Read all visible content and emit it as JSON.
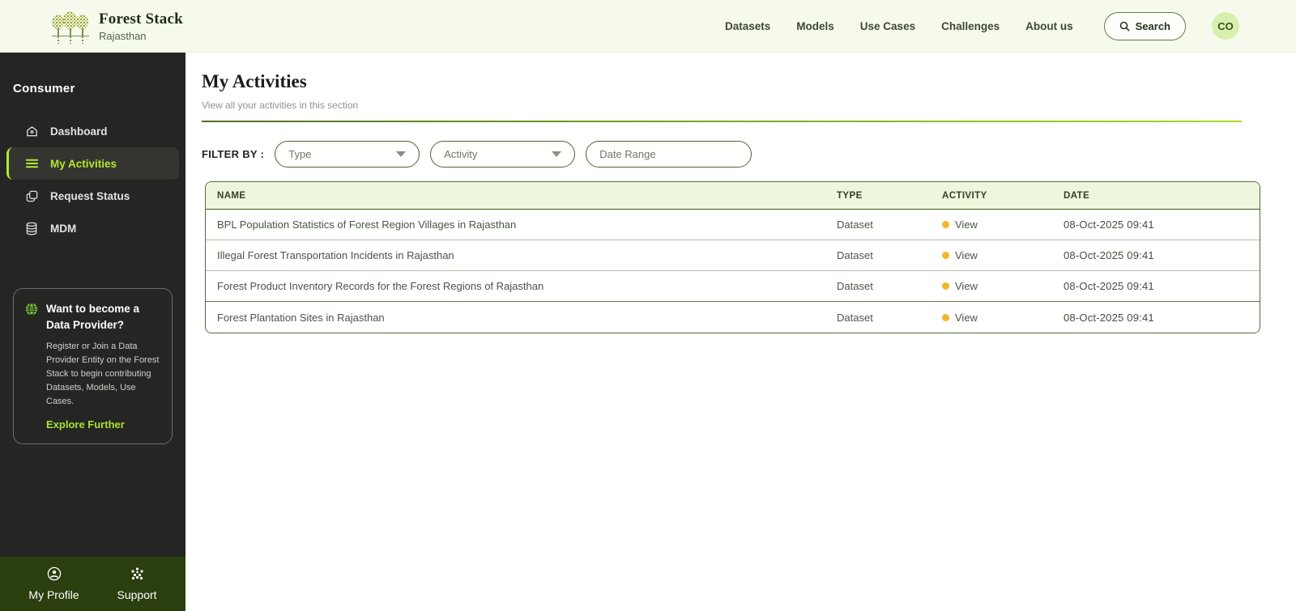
{
  "header": {
    "brand": {
      "title": "Forest Stack",
      "subtitle": "Rajasthan"
    },
    "nav": [
      {
        "label": "Datasets"
      },
      {
        "label": "Models"
      },
      {
        "label": "Use Cases"
      },
      {
        "label": "Challenges"
      },
      {
        "label": "About us"
      }
    ],
    "search_label": "Search",
    "avatar_initials": "CO"
  },
  "sidebar": {
    "role": "Consumer",
    "items": [
      {
        "label": "Dashboard",
        "icon": "home-icon",
        "active": false
      },
      {
        "label": "My Activities",
        "icon": "menu-lines-icon",
        "active": true
      },
      {
        "label": "Request Status",
        "icon": "copy-pages-icon",
        "active": false
      },
      {
        "label": "MDM",
        "icon": "database-icon",
        "active": false
      }
    ],
    "promo": {
      "title": "Want to become a Data Provider?",
      "body": "Register or Join a Data Provider Entity on the Forest Stack to begin contributing Datasets, Models, Use Cases.",
      "link": "Explore Further"
    },
    "footer": [
      {
        "label": "My Profile",
        "icon": "profile-icon"
      },
      {
        "label": "Support",
        "icon": "support-icon"
      }
    ]
  },
  "main": {
    "title": "My Activities",
    "subtitle": "View all your activities in this section",
    "filter_label": "FILTER BY :",
    "filters": [
      {
        "label": "Type",
        "has_caret": true
      },
      {
        "label": "Activity",
        "has_caret": true
      },
      {
        "label": "Date Range",
        "has_caret": false
      }
    ],
    "table": {
      "columns": [
        "NAME",
        "TYPE",
        "ACTIVITY",
        "DATE"
      ],
      "rows": [
        {
          "name": "BPL Population Statistics of Forest Region Villages in Rajasthan",
          "type": "Dataset",
          "activity": "View",
          "date": "08-Oct-2025 09:41"
        },
        {
          "name": "Illegal Forest Transportation Incidents in Rajasthan",
          "type": "Dataset",
          "activity": "View",
          "date": "08-Oct-2025 09:41"
        },
        {
          "name": "Forest Product Inventory Records for the Forest Regions of Rajasthan",
          "type": "Dataset",
          "activity": "View",
          "date": "08-Oct-2025 09:41"
        },
        {
          "name": "Forest Plantation Sites in Rajasthan",
          "type": "Dataset",
          "activity": "View",
          "date": "08-Oct-2025 09:41"
        }
      ]
    }
  },
  "colors": {
    "accent_lime": "#b3e82f",
    "header_bg": "#f6faed",
    "sidebar_bg": "#252523",
    "bottom_bar_bg": "#2b3e0e",
    "table_header_bg": "#eef7dc",
    "table_border": "#4f6c38",
    "activity_dot": "#f1b62c",
    "avatar_bg": "#d9efae",
    "divider_gradient": [
      "#52711f",
      "#a4dc27"
    ]
  }
}
